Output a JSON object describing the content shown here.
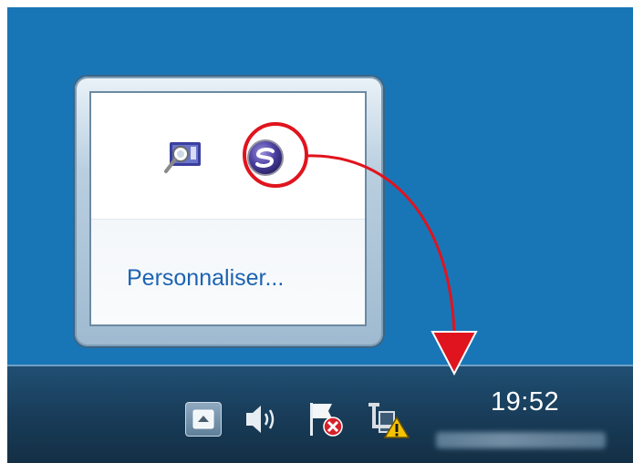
{
  "flyout": {
    "customize_link": "Personnaliser...",
    "icons": [
      {
        "name": "search-camera-icon",
        "interactable": true
      },
      {
        "name": "scansnap-manager-icon",
        "interactable": true,
        "highlighted": true
      }
    ]
  },
  "taskbar": {
    "clock_time": "19:52",
    "tray_icons": [
      "show-hidden-icons-button",
      "volume-icon",
      "action-center-flag-icon",
      "network-warning-icon"
    ]
  },
  "annotation": {
    "highlight_color": "#e0141e",
    "arrow_color": "#e0141e"
  },
  "colors": {
    "desktop": "#1876b7",
    "taskbar": "#1a4261",
    "link": "#1d63b2"
  }
}
